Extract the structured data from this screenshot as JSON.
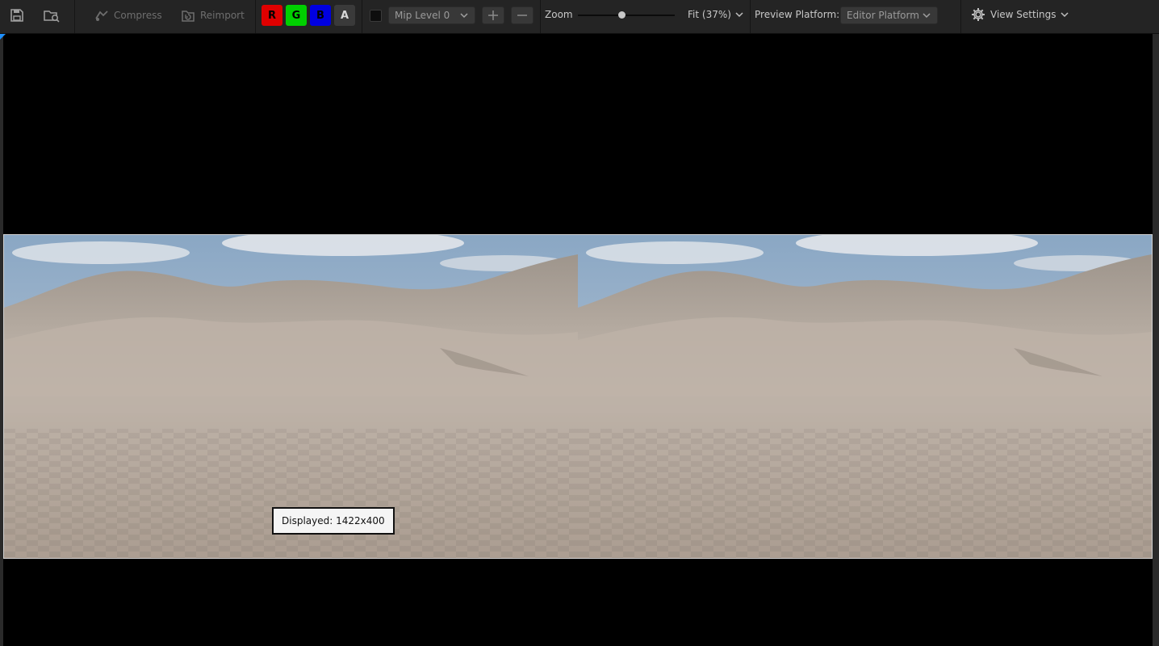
{
  "toolbar": {
    "compress_label": "Compress",
    "reimport_label": "Reimport",
    "channels": [
      {
        "label": "R",
        "color": "#e00000"
      },
      {
        "label": "G",
        "color": "#00d000"
      },
      {
        "label": "B",
        "color": "#0000e0"
      },
      {
        "label": "A",
        "color": "#3a3a3a"
      }
    ],
    "mip_level": "Mip Level 0",
    "zoom_label": "Zoom",
    "zoom_value": "Fit (37%)",
    "zoom_slider_fraction": 0.45,
    "preview_platform_label": "Preview Platform:",
    "preview_platform_value": "Editor Platform",
    "view_settings_label": "View Settings"
  },
  "viewport": {
    "tooltip": "Displayed: 1422x400",
    "accent_color": "#1e90ff"
  }
}
